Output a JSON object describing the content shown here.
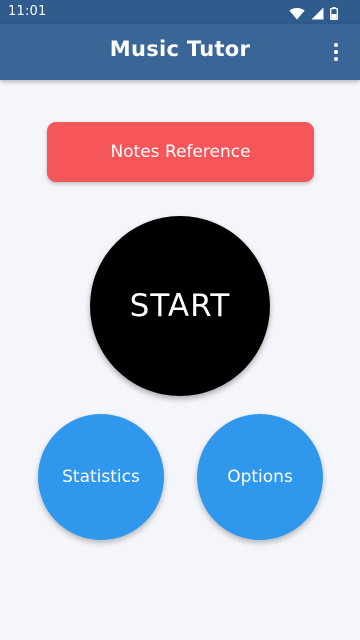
{
  "status_bar": {
    "time": "11:01",
    "icons": [
      "wifi-icon",
      "signal-icon",
      "battery-icon"
    ]
  },
  "app_bar": {
    "title": "Music Tutor",
    "overflow_icon": "more-vert-icon"
  },
  "main": {
    "notes_reference_label": "Notes Reference",
    "start_label": "START",
    "statistics_label": "Statistics",
    "options_label": "Options"
  },
  "colors": {
    "status_bar": "#2f5b8d",
    "app_bar": "#3a6597",
    "background": "#f4f6fb",
    "notes_button": "#f6565a",
    "start_button": "#000000",
    "circle_buttons": "#2f97ec"
  }
}
